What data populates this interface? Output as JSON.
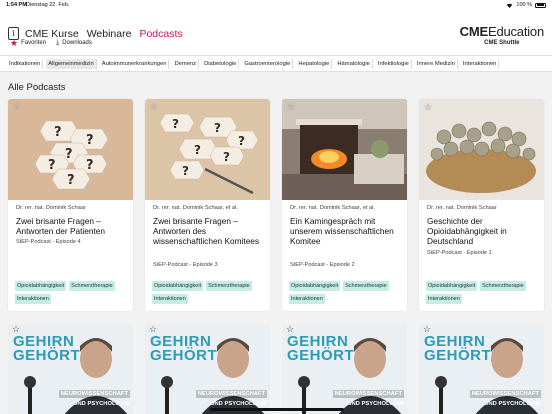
{
  "status": {
    "time": "1:54 PM",
    "date": "Dienstag 22. Feb.",
    "battery": "100 %"
  },
  "header": {
    "info_label": "i",
    "nav": [
      "CME Kurse",
      "Webinare",
      "Podcasts"
    ],
    "brand": {
      "strong": "CME",
      "light": "ducation",
      "sub": "CME Shuttle"
    }
  },
  "actions": {
    "favorites": "Favoriten",
    "downloads": "Downloads"
  },
  "categories": [
    "Indikationen",
    "Allgemeinmedizin",
    "Autoimmunerkrankungen",
    "Demenz",
    "Diabetologie",
    "Gastroenterologie",
    "Hepatologie",
    "Hämatologie",
    "Infektiologie",
    "Innere Medizin",
    "Interaktionen"
  ],
  "section_title": "Alle Podcasts",
  "podcasts": [
    {
      "author": "Dr. rer. nat. Dominik Schaar",
      "title": "Zwei brisante Fragen – Antworten der Patienten",
      "episode": "StEP-Podcast - Episode 4",
      "tags": [
        "Opioidabhängigkeit",
        "Schmerztherapie",
        "Interaktionen"
      ]
    },
    {
      "author": "Dr. rer. nat. Dominik Schaar, et al.",
      "title": "Zwei brisante Fragen – Antworten des wissenschaftlichen Komitees",
      "episode": "StEP-Podcast - Episode 3",
      "tags": [
        "Opioidabhängigkeit",
        "Schmerztherapie",
        "Interaktionen"
      ]
    },
    {
      "author": "Dr. rer. nat. Dominik Schaar, et al.",
      "title": "Ein Kamingespräch mit unserem wissenschaftlichen Komitee",
      "episode": "StEP-Podcast - Episode 2",
      "tags": [
        "Opioidabhängigkeit",
        "Schmerztherapie",
        "Interaktionen"
      ]
    },
    {
      "author": "Dr. rer. nat. Dominik Schaar",
      "title": "Geschichte der Opioidabhängigkeit in Deutschland",
      "episode": "StEP-Podcast - Episode 1",
      "tags": [
        "Opioidabhängigkeit",
        "Schmerztherapie",
        "Interaktionen"
      ]
    }
  ],
  "gehirn": {
    "line1": "GEHIRN",
    "line2": "GEHÖRT",
    "banner1": "NEUROWISSENSCHAFT",
    "banner2": "UND PSYCHOLOGIE"
  },
  "colors": {
    "accent": "#c2185b",
    "tag_bg": "#c5ede3",
    "gehirn_blue": "#2c9cb8"
  }
}
